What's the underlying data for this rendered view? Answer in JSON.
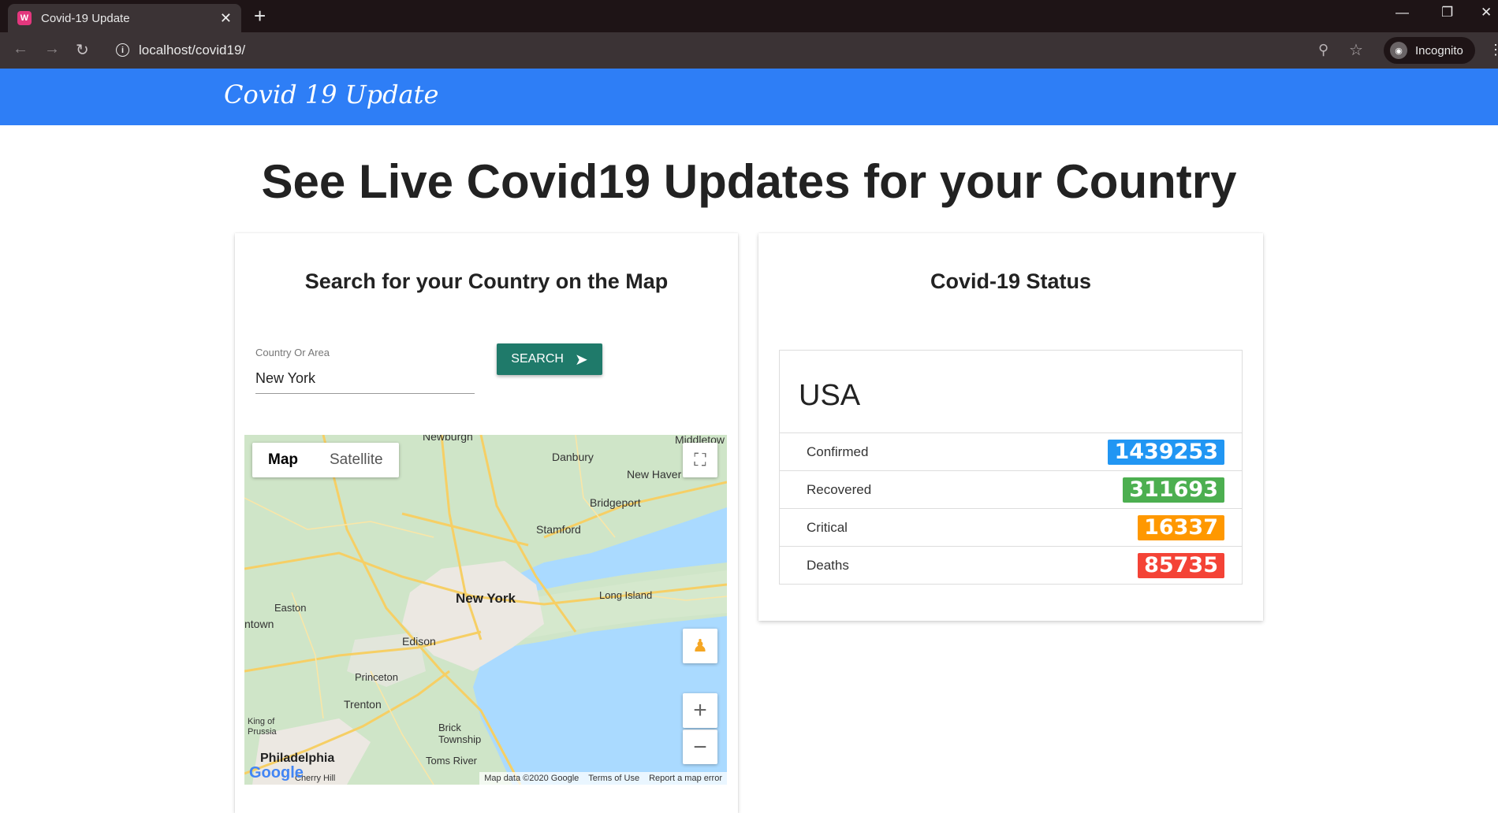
{
  "browser": {
    "tab_title": "Covid-19 Update",
    "favicon_text": "W",
    "new_tab": "+",
    "url": "localhost/covid19/",
    "incognito_label": "Incognito"
  },
  "header": {
    "brand": "Covid 19 Update"
  },
  "page": {
    "title": "See Live Covid19 Updates for your Country"
  },
  "search_card": {
    "title": "Search for your Country on the Map",
    "field_label": "Country Or Area",
    "field_value": "New York",
    "search_label": "SEARCH"
  },
  "map": {
    "type_map": "Map",
    "type_satellite": "Satellite",
    "labels": {
      "newburgh": "Newburgh",
      "middletown": "Middletow",
      "danbury": "Danbury",
      "new_haven": "New Haver",
      "bridgeport": "Bridgeport",
      "stamford": "Stamford",
      "new_york": "New York",
      "long_island": "Long Island",
      "easton": "Easton",
      "allentown": "ntown",
      "edison": "Edison",
      "princeton": "Princeton",
      "trenton": "Trenton",
      "king_of_prussia": "King of\nPrussia",
      "brick": "Brick\nTownship",
      "toms_river": "Toms River",
      "philadelphia": "Philadelphia",
      "cherry_hill": "Cherry Hill"
    },
    "google": "Google",
    "footer_data": "Map data ©2020 Google",
    "footer_terms": "Terms of Use",
    "footer_report": "Report a map error",
    "colors": {
      "land": "#cfe5c8",
      "water": "#aadaff",
      "urban": "#ece8e2",
      "highway": "#f6cf65"
    }
  },
  "status_card": {
    "title": "Covid-19 Status",
    "country": "USA",
    "rows": [
      {
        "label": "Confirmed",
        "value": "1439253",
        "color": "#2196f3"
      },
      {
        "label": "Recovered",
        "value": "311693",
        "color": "#4caf50"
      },
      {
        "label": "Critical",
        "value": "16337",
        "color": "#ff9800"
      },
      {
        "label": "Deaths",
        "value": "85735",
        "color": "#f44336"
      }
    ]
  },
  "icons": {
    "tab_close": "✕",
    "back": "←",
    "forward": "→",
    "reload": "↻",
    "info": "i",
    "zoom": "⚲",
    "star": "☆",
    "menu": "⋮",
    "minimize": "—",
    "restore": "❐",
    "close": "✕",
    "send": "➤",
    "fullscreen": "⛶",
    "pegman": "♟",
    "zoom_in": "+",
    "zoom_out": "−"
  }
}
